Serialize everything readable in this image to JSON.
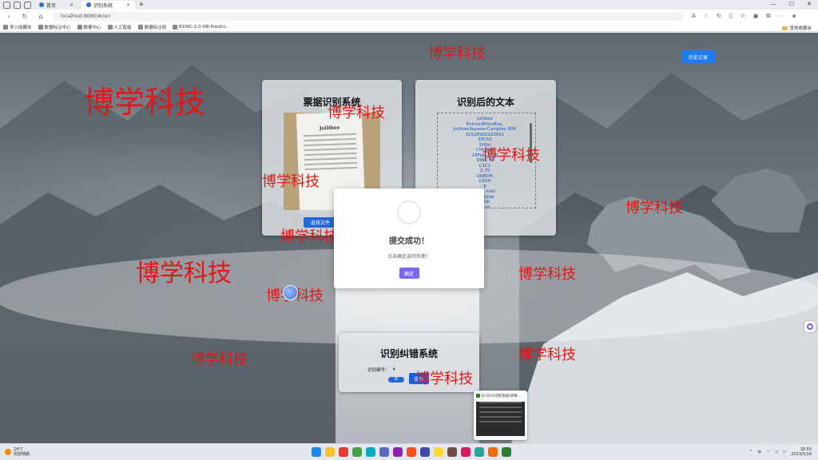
{
  "browser": {
    "tabs": [
      {
        "label": "首页"
      },
      {
        "label": "识别系统"
      }
    ],
    "new_tab": "+",
    "url": "localhost:8080/#/ocr",
    "bookmarks": [
      "导入收藏夹",
      "数据标注中心",
      "数据中心",
      "人工智能",
      "数据标注组",
      "EXHIC-2.0-DB-Predict..."
    ],
    "bookmarks_right": "其他收藏夹"
  },
  "page": {
    "history_button": "历史记录",
    "upload_panel": {
      "title": "票据识别系统",
      "upload_button": "选择文件",
      "receipt_logo": "Jollibee"
    },
    "text_panel": {
      "title": "识别后的文本",
      "lines": [
        "Jollibee",
        "Entrek/B5dvBhe.",
        "JollibeeYayasanComplex B06",
        "32528902232891",
        "2PC52",
        "2Hlbr",
        "Chk 90p",
        "18Feb 2018",
        "DINE IN",
        "C1C1",
        "3.70",
        "UNBDR",
        "CASH",
        "Tr",
        "Item sold",
        "",
        "Subtotal",
        "Total",
        "Cash"
      ]
    },
    "correction_panel": {
      "title": "识别纠错系统",
      "field_label": "识别编号：",
      "field_value": "4",
      "toggle_label": "开",
      "submit_button": "提交"
    },
    "modal": {
      "title": "提交成功！",
      "message": "点击确定返回页面！",
      "ok_button": "确定"
    },
    "watermark_text": "博学科技",
    "thumbnail_title": "D:\\OCR识别系统\\项目..."
  },
  "taskbar": {
    "weather_temp": "24°C",
    "weather_desc": "局部晴朗",
    "time": "18:50",
    "date": "2023/5/16",
    "lang": "中",
    "app_colors": [
      "#1e88e5",
      "#fbc02d",
      "#e53935",
      "#43a047",
      "#00acc1",
      "#5c6bc0",
      "#8e24aa",
      "#f4511e",
      "#3949ab",
      "#fdd835",
      "#6d4c41",
      "#d81b60",
      "#26a69a",
      "#ef6c00",
      "#2e7d32"
    ]
  }
}
